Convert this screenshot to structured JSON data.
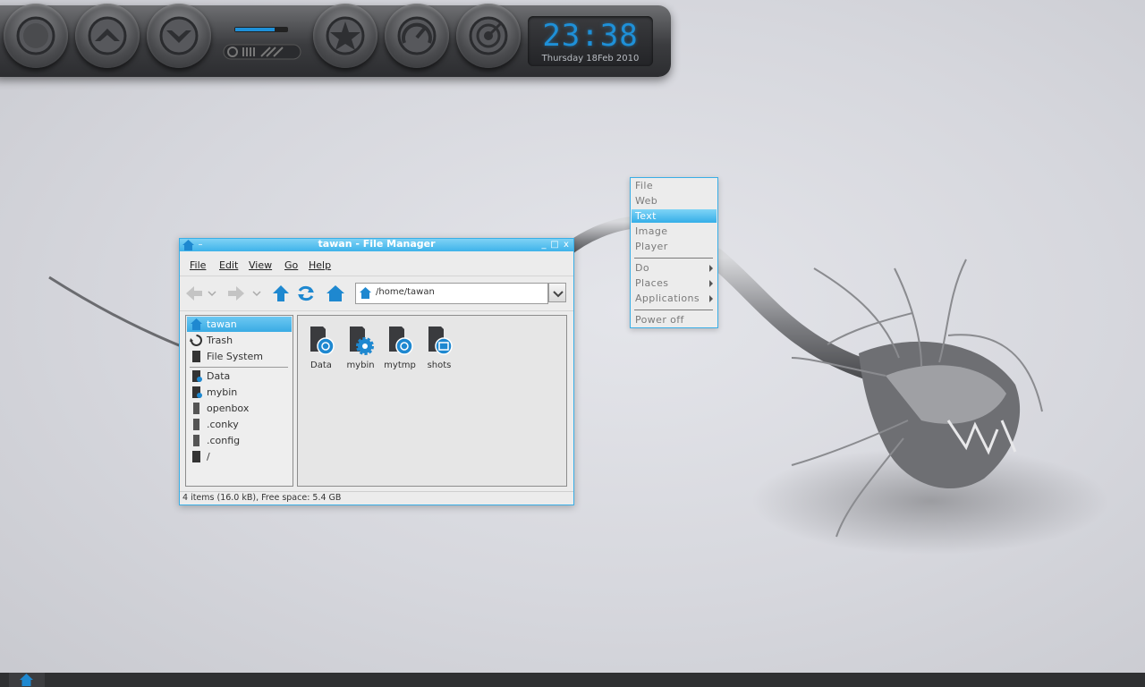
{
  "dock": {
    "buttons": [
      {
        "icon": "ring-icon"
      },
      {
        "icon": "chevron-up-icon"
      },
      {
        "icon": "chevron-down-icon"
      },
      {
        "icon": "star-icon"
      },
      {
        "icon": "gauge-icon"
      },
      {
        "icon": "target-icon"
      }
    ],
    "meter_icon": "meter-icon",
    "clock": {
      "time": "23:38",
      "date": "Thursday 18Feb 2010"
    },
    "accent": "#1e90d8"
  },
  "file_manager": {
    "title": "tawan - File Manager",
    "controls": {
      "minimize": "_",
      "maximize": "□",
      "close": "x"
    },
    "menu": [
      "File",
      "Edit",
      "View",
      "Go",
      "Help"
    ],
    "toolbar_icons": [
      "back-arrow-icon",
      "dropdown-icon",
      "forward-arrow-icon",
      "dropdown-icon",
      "up-arrow-icon",
      "reload-icon",
      "home-icon"
    ],
    "address": "/home/tawan",
    "sidebar": [
      {
        "label": "tawan",
        "icon": "home-icon",
        "selected": true
      },
      {
        "label": "Trash",
        "icon": "trash-icon"
      },
      {
        "label": "File System",
        "icon": "drive-icon"
      },
      {
        "label": "Data",
        "icon": "folder-icon"
      },
      {
        "label": "mybin",
        "icon": "folder-gear-icon"
      },
      {
        "label": "openbox",
        "icon": "folder-icon"
      },
      {
        "label": ".conky",
        "icon": "folder-icon"
      },
      {
        "label": ".config",
        "icon": "folder-icon"
      },
      {
        "label": "/",
        "icon": "drive-icon"
      }
    ],
    "files": [
      {
        "label": "Data",
        "icon": "folder-link-icon"
      },
      {
        "label": "mybin",
        "icon": "folder-gear-icon"
      },
      {
        "label": "mytmp",
        "icon": "folder-link-icon"
      },
      {
        "label": "shots",
        "icon": "folder-image-icon"
      }
    ],
    "status": "4 items (16.0 kB), Free space: 5.4 GB",
    "accent": "#3aaee6"
  },
  "context_menu": {
    "items": [
      {
        "label": "File"
      },
      {
        "label": "Web"
      },
      {
        "label": "Text",
        "selected": true
      },
      {
        "label": "Image"
      },
      {
        "label": "Player"
      },
      {
        "label": "Do",
        "submenu": true
      },
      {
        "label": "Places",
        "submenu": true
      },
      {
        "label": "Applications",
        "submenu": true
      },
      {
        "label": "Power off"
      }
    ]
  },
  "taskbar": {
    "icon": "home-icon"
  }
}
